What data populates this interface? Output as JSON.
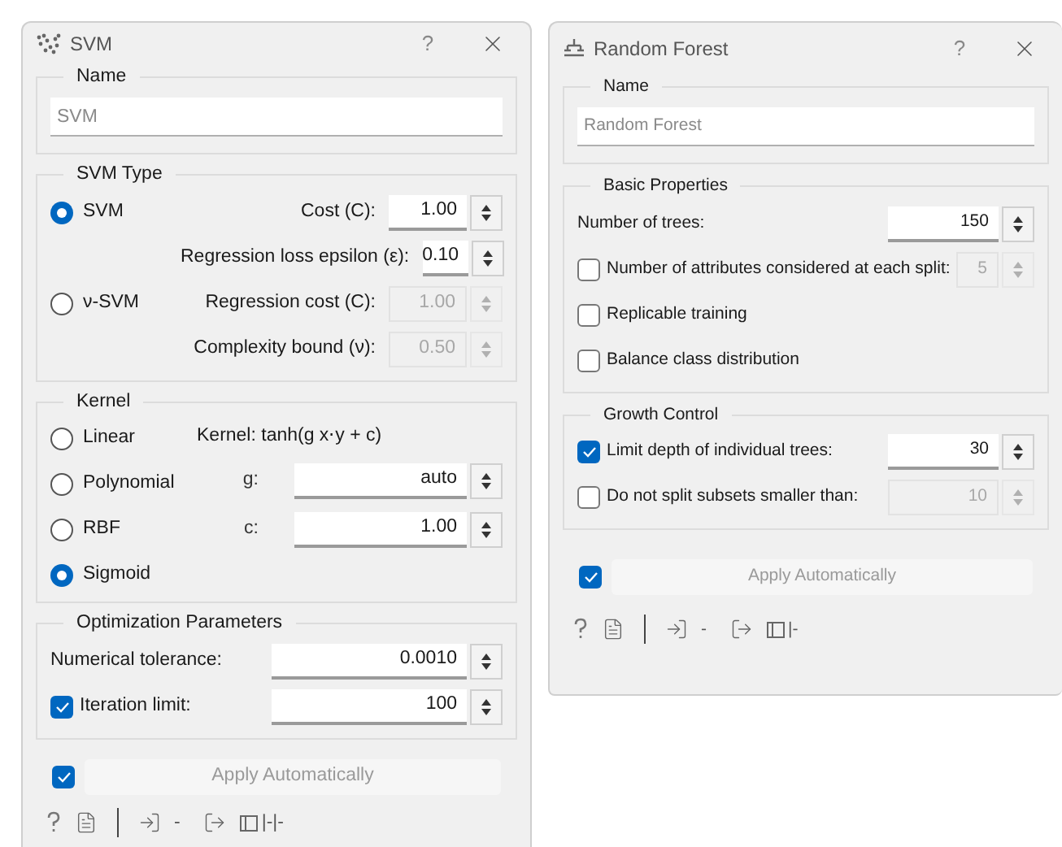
{
  "windows": [
    {
      "title": "SVM",
      "help": "?",
      "sections": [
        {
          "kind": "name",
          "title": "Name",
          "placeholder": "SVM"
        },
        {
          "kind": "radio_grid",
          "title": "SVM Type",
          "rows": [
            {
              "radio": {
                "label": "SVM",
                "selected": true
              },
              "label": "Cost (C):",
              "value": "1.00",
              "disabled": false
            },
            {
              "label": "Regression loss epsilon (ε):",
              "value": "0.10",
              "disabled": false
            },
            {
              "radio": {
                "label": "ν-SVM",
                "selected": false
              },
              "label": "Regression cost (C):",
              "value": "1.00",
              "disabled": true
            },
            {
              "label": "Complexity bound (ν):",
              "value": "0.50",
              "disabled": true
            }
          ]
        },
        {
          "kind": "kernel",
          "title": "Kernel",
          "options": [
            {
              "label": "Linear",
              "selected": false
            },
            {
              "label": "Polynomial",
              "selected": false
            },
            {
              "label": "RBF",
              "selected": false
            },
            {
              "label": "Sigmoid",
              "selected": true
            }
          ],
          "formula": "Kernel: tanh(g x⋅y + c)",
          "params": [
            {
              "label": "g:",
              "value": "auto",
              "disabled": false
            },
            {
              "label": "c:",
              "value": "1.00",
              "disabled": false
            }
          ]
        },
        {
          "kind": "form",
          "title": "Optimization Parameters",
          "rows": [
            {
              "label": "Numerical tolerance:",
              "value": "0.0010",
              "disabled": false
            },
            {
              "checked": true,
              "label": "Iteration limit:",
              "value": "100",
              "disabled": false
            }
          ]
        }
      ],
      "apply": {
        "checked": true,
        "label": "Apply Automatically"
      },
      "footer": {
        "input_status": "-",
        "output_status": "|-|-"
      }
    },
    {
      "title": "Random Forest",
      "help": "?",
      "sections": [
        {
          "kind": "name",
          "title": "Name",
          "placeholder": "Random Forest"
        },
        {
          "kind": "form",
          "title": "Basic Properties",
          "rows": [
            {
              "label": "Number of trees:",
              "value": "150",
              "disabled": false
            },
            {
              "checked": false,
              "label": "Number of attributes considered at each split:",
              "value": "5",
              "disabled": true
            },
            {
              "checked": false,
              "label": "Replicable training"
            },
            {
              "checked": false,
              "label": "Balance class distribution"
            }
          ]
        },
        {
          "kind": "form",
          "title": "Growth Control",
          "rows": [
            {
              "checked": true,
              "label": "Limit depth of individual trees:",
              "value": "30",
              "disabled": false
            },
            {
              "checked": false,
              "label": "Do not split subsets smaller than:",
              "value": "10",
              "disabled": true
            }
          ]
        }
      ],
      "apply": {
        "checked": true,
        "label": "Apply Automatically"
      },
      "footer": {
        "input_status": "-",
        "output_status": "|-"
      }
    }
  ]
}
